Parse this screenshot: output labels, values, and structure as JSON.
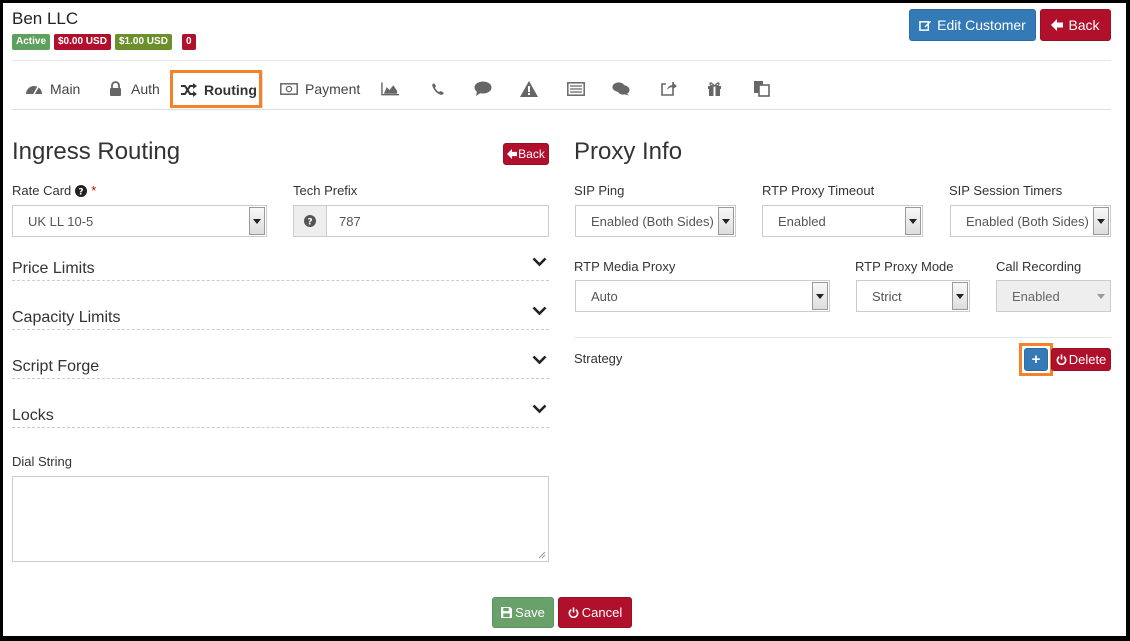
{
  "customer": {
    "name": "Ben LLC",
    "badges": [
      "Active",
      "$0.00 USD",
      "$1.00 USD",
      "0"
    ],
    "badge_colors": [
      "#5ea05e",
      "#b0102c",
      "#6b8f2a",
      "#b0102c"
    ]
  },
  "header": {
    "edit_label": "Edit Customer",
    "back_label": "Back"
  },
  "tabs": {
    "main": "Main",
    "auth": "Auth",
    "routing": "Routing",
    "payment": "Payment"
  },
  "ingress": {
    "title": "Ingress Routing",
    "back_label": "Back",
    "rate_card_label": "Rate Card",
    "required_mark": "*",
    "rate_card_value": "UK LL 10-5",
    "tech_prefix_label": "Tech Prefix",
    "tech_prefix_value": "787",
    "sections": [
      "Price Limits",
      "Capacity Limits",
      "Script Forge",
      "Locks"
    ],
    "dial_string_label": "Dial String"
  },
  "proxy": {
    "title": "Proxy Info",
    "sip_ping_label": "SIP Ping",
    "sip_ping_value": "Enabled (Both Sides)",
    "rtp_timeout_label": "RTP Proxy Timeout",
    "rtp_timeout_value": "Enabled",
    "sip_timers_label": "SIP Session Timers",
    "sip_timers_value": "Enabled (Both Sides)",
    "rtp_media_label": "RTP Media Proxy",
    "rtp_media_value": "Auto",
    "rtp_mode_label": "RTP Proxy Mode",
    "rtp_mode_value": "Strict",
    "call_rec_label": "Call Recording",
    "call_rec_value": "Enabled",
    "strategy_label": "Strategy",
    "add_label": "+",
    "delete_label": "Delete"
  },
  "footer": {
    "save_label": "Save",
    "cancel_label": "Cancel"
  },
  "colors": {
    "highlight": "#f5822a",
    "primary": "#337ab7",
    "danger": "#b0102c",
    "success": "#6aa06a"
  }
}
